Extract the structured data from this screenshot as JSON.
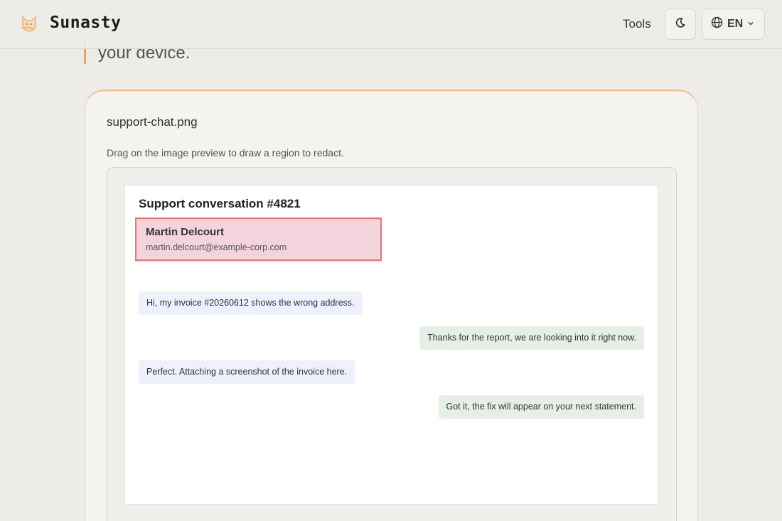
{
  "header": {
    "brand": "Sunasty",
    "tools_label": "Tools",
    "language": "EN",
    "icons": {
      "logo": "fox-logo-icon",
      "theme": "moon-icon",
      "language": "globe-icon",
      "dropdown": "chevron-down-icon"
    }
  },
  "intro": {
    "text": "your device."
  },
  "card": {
    "filename": "support-chat.png",
    "hint": "Drag on the image preview to draw a region to redact.",
    "preview": {
      "title": "Support conversation #4821",
      "redacted_region": {
        "name": "Martin Delcourt",
        "email": "martin.delcourt@example-corp.com"
      },
      "messages": [
        {
          "side": "incoming",
          "text": "Hi, my invoice #20260612 shows the wrong address."
        },
        {
          "side": "outgoing",
          "text": "Thanks for the report, we are looking into it right now."
        },
        {
          "side": "incoming",
          "text": "Perfect. Attaching a screenshot of the invoice here."
        },
        {
          "side": "outgoing",
          "text": "Got it, the fix will appear on your next statement."
        }
      ]
    }
  },
  "colors": {
    "background": "#eeece7",
    "accent": "#e8a85a",
    "redact_fill": "#f3d3dc",
    "redact_border": "#e8736f"
  }
}
